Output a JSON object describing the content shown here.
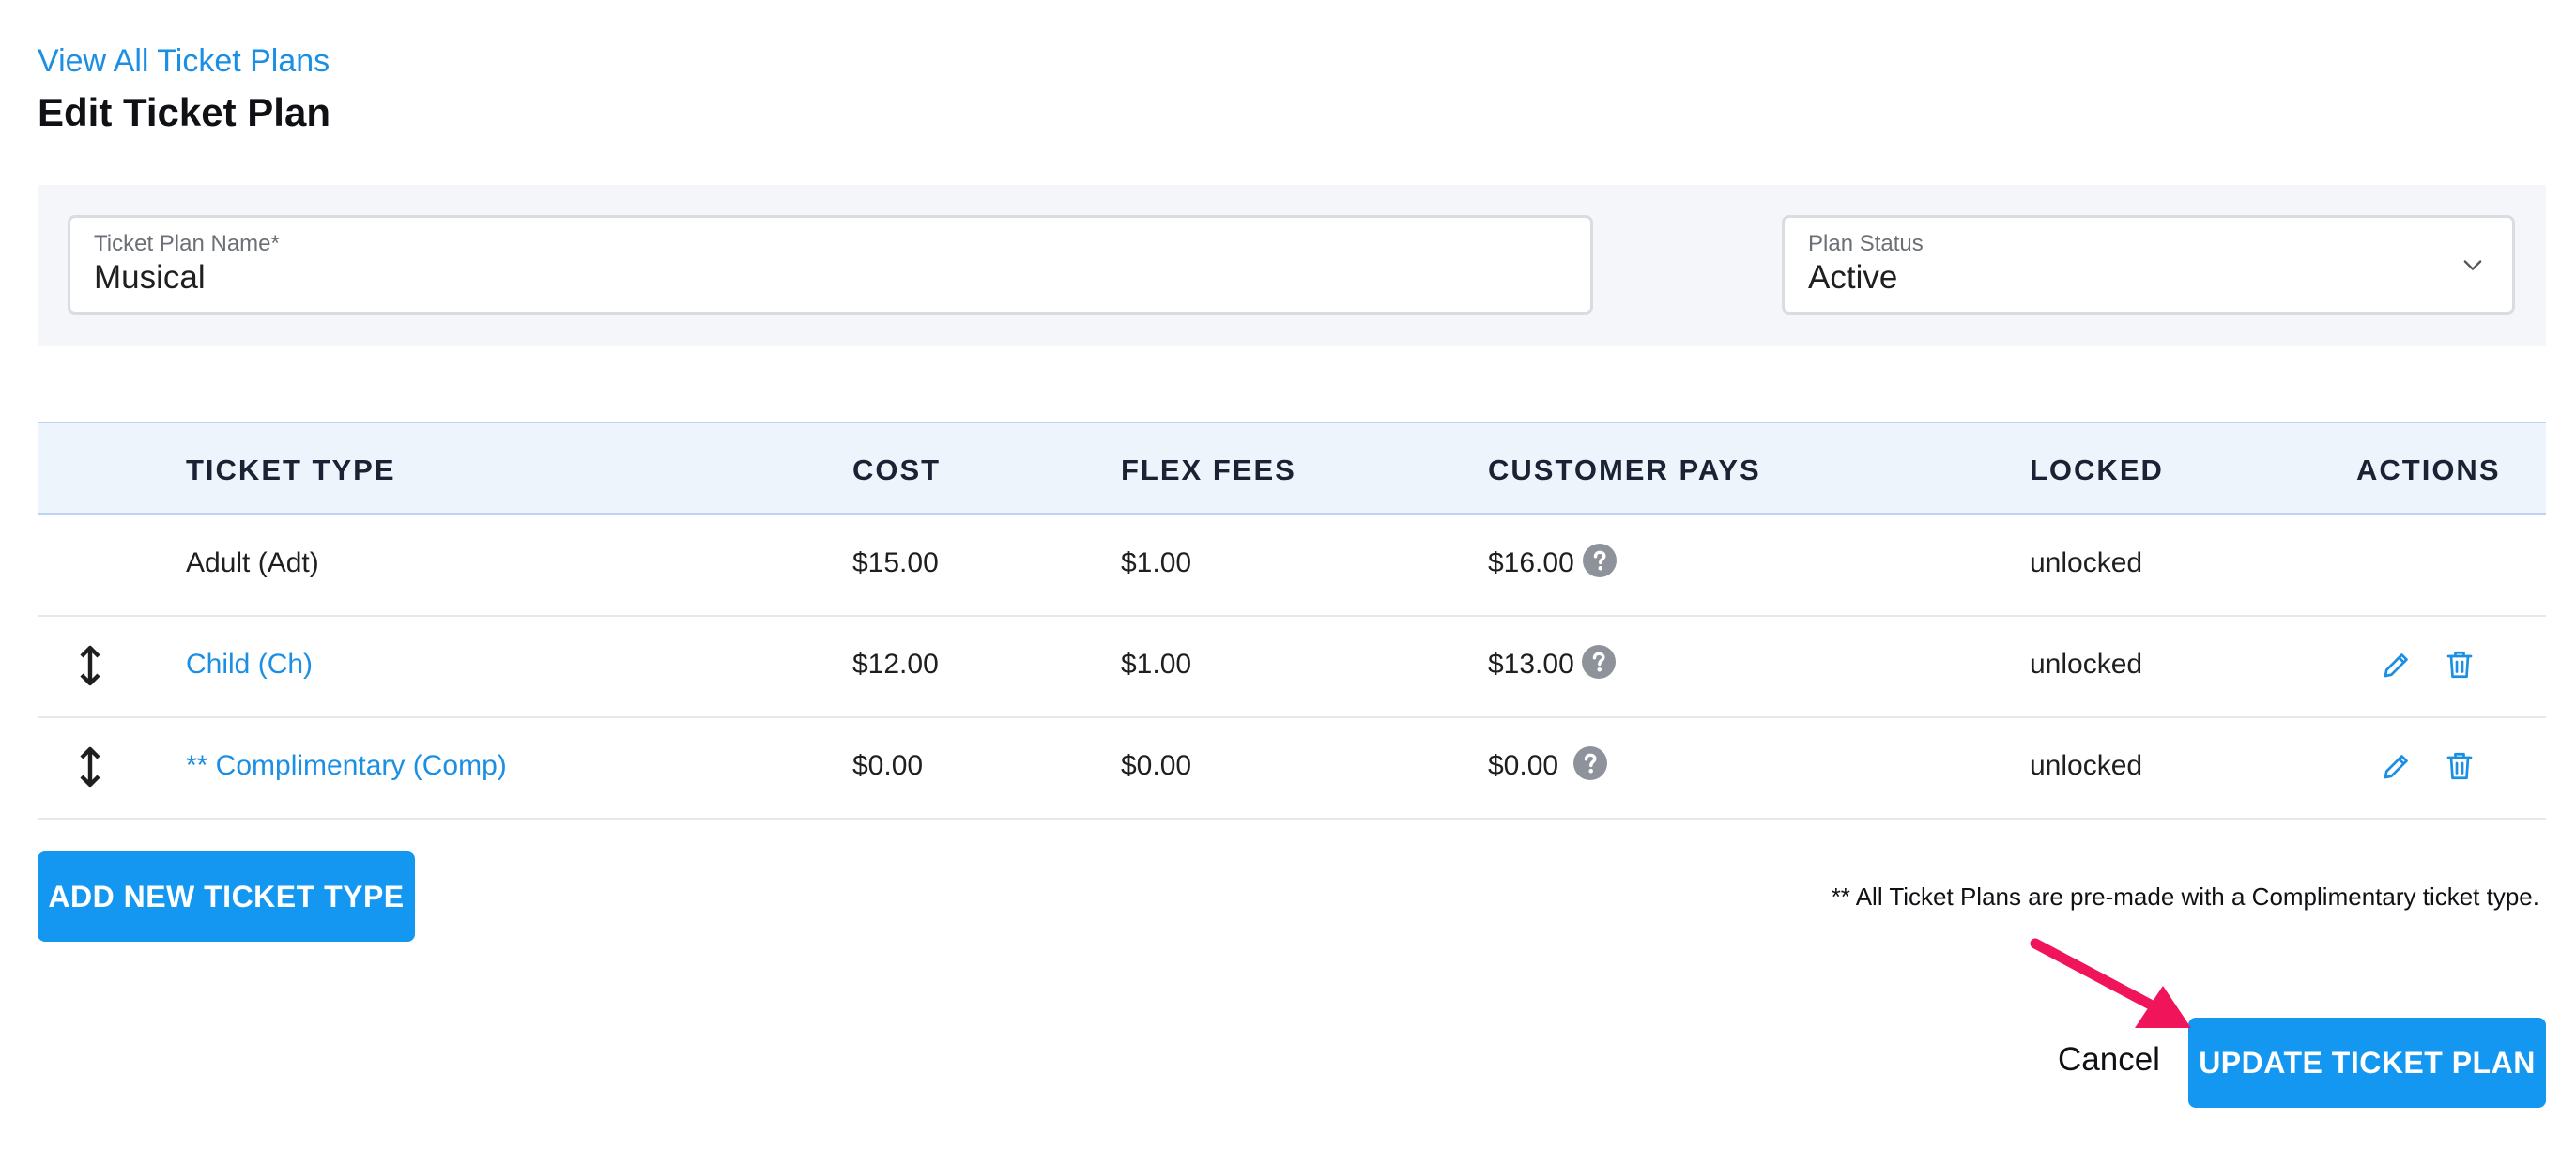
{
  "header": {
    "back_link": "View All Ticket Plans",
    "title": "Edit Ticket Plan"
  },
  "form": {
    "name_label": "Ticket Plan Name*",
    "name_value": "Musical",
    "status_label": "Plan Status",
    "status_value": "Active"
  },
  "table": {
    "columns": [
      "TICKET TYPE",
      "COST",
      "FLEX FEES",
      "CUSTOMER PAYS",
      "LOCKED",
      "ACTIONS"
    ],
    "rows": [
      {
        "ticket_type": "Adult (Adt)",
        "cost": "$15.00",
        "flex_fees": "$1.00",
        "customer_pays": "$16.00",
        "locked": "unlocked",
        "editable": false
      },
      {
        "ticket_type": "Child (Ch)",
        "cost": "$12.00",
        "flex_fees": "$1.00",
        "customer_pays": "$13.00",
        "locked": "unlocked",
        "editable": true
      },
      {
        "ticket_type": "** Complimentary (Comp)",
        "cost": "$0.00",
        "flex_fees": "$0.00",
        "customer_pays": "$0.00",
        "locked": "unlocked",
        "editable": true
      }
    ]
  },
  "actions": {
    "add_label": "ADD NEW TICKET TYPE",
    "note": "** All Ticket Plans are pre-made with a Complimentary ticket type.",
    "cancel_label": "Cancel",
    "update_label": "UPDATE TICKET PLAN"
  },
  "icons": {
    "chevron": "chevron-down-icon",
    "help": "question-circle-icon",
    "drag": "drag-handle-icon",
    "edit": "pencil-icon",
    "delete": "trash-icon",
    "annotation": "arrow-annotation"
  },
  "colors": {
    "accent": "#1497f0",
    "link": "#1a8fe3",
    "annotation_arrow": "#f0155a",
    "help_icon": "#8e929a"
  }
}
